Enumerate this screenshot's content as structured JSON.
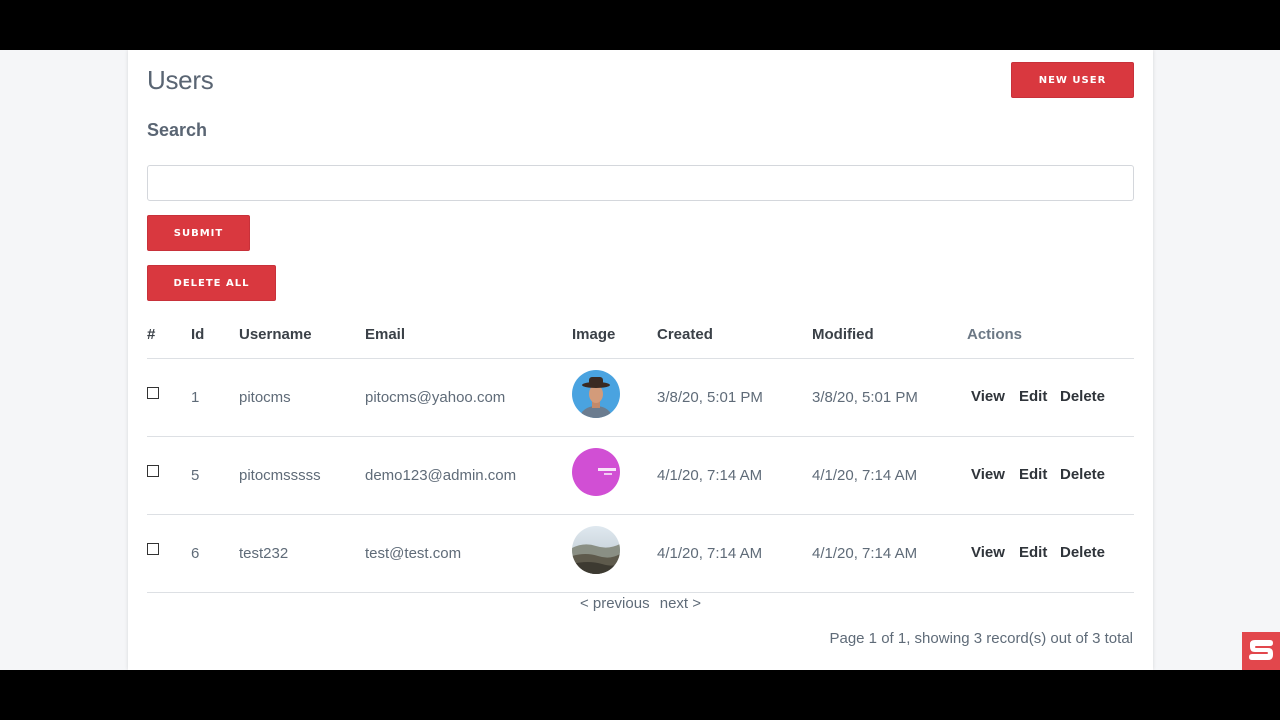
{
  "page": {
    "title": "Users",
    "new_user_label": "NEW USER"
  },
  "search": {
    "label": "Search",
    "value": "",
    "placeholder": "",
    "submit_label": "SUBMIT"
  },
  "bulk": {
    "delete_all_label": "DELETE ALL"
  },
  "table": {
    "headers": {
      "select": "#",
      "id": "Id",
      "username": "Username",
      "email": "Email",
      "image": "Image",
      "created": "Created",
      "modified": "Modified",
      "actions": "Actions"
    },
    "rows": [
      {
        "id": "1",
        "username": "pitocms",
        "email": "pitocms@yahoo.com",
        "avatar": "person-hat-avatar",
        "created": "3/8/20, 5:01 PM",
        "modified": "3/8/20, 5:01 PM",
        "view": "View",
        "edit": "Edit",
        "delete": "Delete"
      },
      {
        "id": "5",
        "username": "pitocmsssss",
        "email": "demo123@admin.com",
        "avatar": "magenta-logo-avatar",
        "created": "4/1/20, 7:14 AM",
        "modified": "4/1/20, 7:14 AM",
        "view": "View",
        "edit": "Edit",
        "delete": "Delete"
      },
      {
        "id": "6",
        "username": "test232",
        "email": "test@test.com",
        "avatar": "landscape-avatar",
        "created": "4/1/20, 7:14 AM",
        "modified": "4/1/20, 7:14 AM",
        "view": "View",
        "edit": "Edit",
        "delete": "Delete"
      }
    ]
  },
  "pagination": {
    "previous": "< previous",
    "next": "next >",
    "summary": "Page 1 of 1, showing 3 record(s) out of 3 total"
  },
  "colors": {
    "accent": "#d9383f",
    "text": "#5f6b78",
    "heading": "#3b4148"
  },
  "overlay": {
    "logo_icon": "channel-logo-icon"
  }
}
